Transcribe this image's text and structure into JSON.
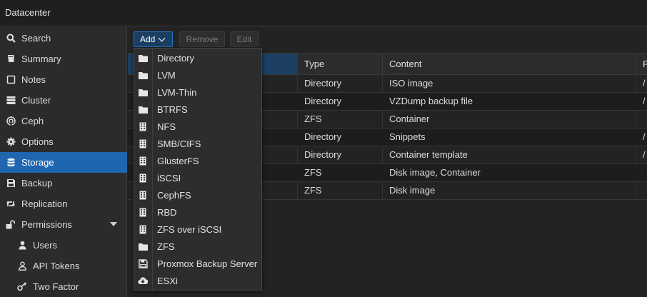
{
  "header": {
    "title": "Datacenter"
  },
  "sidebar": {
    "items": [
      {
        "label": "Search",
        "icon": "search-icon"
      },
      {
        "label": "Summary",
        "icon": "book-icon"
      },
      {
        "label": "Notes",
        "icon": "note-icon"
      },
      {
        "label": "Cluster",
        "icon": "server-icon"
      },
      {
        "label": "Ceph",
        "icon": "ceph-icon"
      },
      {
        "label": "Options",
        "icon": "gear-icon"
      },
      {
        "label": "Storage",
        "icon": "database-icon",
        "active": true
      },
      {
        "label": "Backup",
        "icon": "floppy-icon"
      },
      {
        "label": "Replication",
        "icon": "retweet-icon"
      },
      {
        "label": "Permissions",
        "icon": "unlock-icon",
        "expanded": true
      },
      {
        "label": "Users",
        "icon": "user-icon",
        "sub": true
      },
      {
        "label": "API Tokens",
        "icon": "user-outline-icon",
        "sub": true
      },
      {
        "label": "Two Factor",
        "icon": "key-icon",
        "sub": true
      }
    ]
  },
  "toolbar": {
    "add_label": "Add",
    "remove_label": "Remove",
    "edit_label": "Edit"
  },
  "grid": {
    "columns": [
      "Type",
      "Content",
      "P"
    ],
    "rows": [
      {
        "type": "Directory",
        "content": "ISO image",
        "path": "/"
      },
      {
        "type": "Directory",
        "content": "VZDump backup file",
        "path": "/"
      },
      {
        "type": "ZFS",
        "content": "Container",
        "path": ""
      },
      {
        "type": "Directory",
        "content": "Snippets",
        "path": "/"
      },
      {
        "type": "Directory",
        "content": "Container template",
        "path": "/"
      },
      {
        "type": "ZFS",
        "content": "Disk image, Container",
        "path": ""
      },
      {
        "type": "ZFS",
        "content": "Disk image",
        "path": ""
      }
    ]
  },
  "add_menu": {
    "items": [
      {
        "label": "Directory",
        "icon": "folder-icon"
      },
      {
        "label": "LVM",
        "icon": "folder-icon"
      },
      {
        "label": "LVM-Thin",
        "icon": "folder-icon"
      },
      {
        "label": "BTRFS",
        "icon": "folder-icon"
      },
      {
        "label": "NFS",
        "icon": "building-icon"
      },
      {
        "label": "SMB/CIFS",
        "icon": "building-icon"
      },
      {
        "label": "GlusterFS",
        "icon": "building-icon"
      },
      {
        "label": "iSCSI",
        "icon": "building-icon"
      },
      {
        "label": "CephFS",
        "icon": "building-icon"
      },
      {
        "label": "RBD",
        "icon": "building-icon"
      },
      {
        "label": "ZFS over iSCSI",
        "icon": "building-icon"
      },
      {
        "label": "ZFS",
        "icon": "folder-icon"
      },
      {
        "label": "Proxmox Backup Server",
        "icon": "floppy-icon"
      },
      {
        "label": "ESXi",
        "icon": "cloud-download-icon"
      }
    ]
  },
  "colors": {
    "accent": "#1f66b0",
    "background": "#232323",
    "sidebar": "#2b2b2b"
  }
}
